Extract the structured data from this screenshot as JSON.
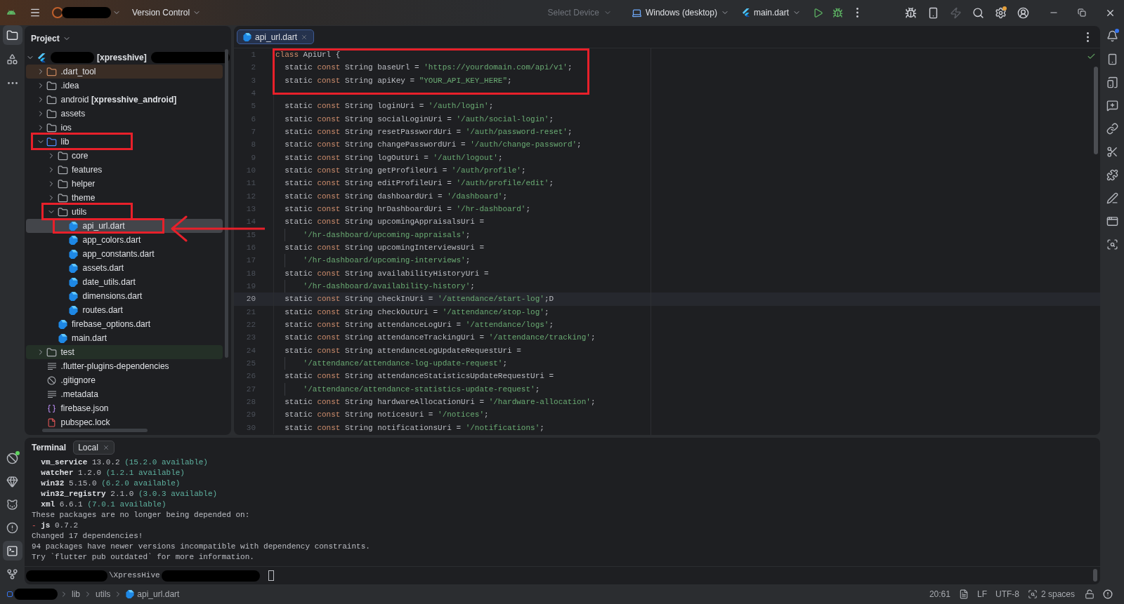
{
  "title_bar": {
    "vcs_menu": {
      "label": "Version Control"
    },
    "device_selector": {
      "label": "Select Device",
      "disabled": true
    },
    "target_selector": {
      "label": "Windows (desktop)"
    },
    "run_configuration": {
      "label": "main.dart"
    },
    "actions": [
      {
        "kind": "run",
        "disabled": false
      },
      {
        "kind": "debug",
        "disabled": false
      },
      {
        "kind": "more",
        "disabled": false
      }
    ],
    "tools": [
      {
        "kind": "attach-debugger",
        "disabled": false,
        "badge": false
      },
      {
        "kind": "device-mirroring",
        "disabled": false,
        "badge": false
      },
      {
        "kind": "hot-reload",
        "disabled": true,
        "badge": false
      },
      {
        "kind": "search",
        "disabled": false,
        "badge": false
      },
      {
        "kind": "settings",
        "disabled": false,
        "badge": true
      },
      {
        "kind": "account",
        "disabled": false,
        "badge": false
      }
    ]
  },
  "left_toolbar": {
    "top": [
      {
        "kind": "project",
        "selected": true
      },
      {
        "kind": "structure",
        "selected": false
      },
      {
        "kind": "more",
        "selected": false
      }
    ],
    "bottom": [
      {
        "kind": "inspector",
        "selected": false,
        "badge": true
      },
      {
        "kind": "gem",
        "selected": false,
        "badge": false
      },
      {
        "kind": "cat",
        "selected": false,
        "badge": false
      },
      {
        "kind": "problems",
        "selected": false,
        "badge": false
      },
      {
        "kind": "terminal",
        "selected": true,
        "badge": false
      },
      {
        "kind": "git",
        "selected": false,
        "badge": false
      }
    ]
  },
  "project_panel": {
    "title": "Project",
    "tree": [
      {
        "kind": "flutter-project",
        "label": "[xpresshive]",
        "expanded": true,
        "selected": false,
        "annotated": false,
        "arrow": false,
        "children": [
          {
            "kind": "excluded-folder",
            "label": ".dart_tool",
            "expanded": false,
            "selected": false,
            "annotated": false,
            "arrow": false
          },
          {
            "kind": "config-folder",
            "label": ".idea",
            "expanded": false,
            "selected": false,
            "annotated": false,
            "arrow": false
          },
          {
            "kind": "folder",
            "label": "android **[xpresshive_android]**",
            "expanded": false,
            "selected": false,
            "annotated": false,
            "arrow": false
          },
          {
            "kind": "folder",
            "label": "assets",
            "expanded": false,
            "selected": false,
            "annotated": false,
            "arrow": false
          },
          {
            "kind": "folder",
            "label": "ios",
            "expanded": false,
            "selected": false,
            "annotated": false,
            "arrow": false
          },
          {
            "kind": "source-folder",
            "label": "lib",
            "expanded": true,
            "selected": false,
            "annotated": true,
            "arrow": false,
            "children": [
              {
                "kind": "folder",
                "label": "core",
                "expanded": false,
                "selected": false,
                "annotated": false,
                "arrow": false
              },
              {
                "kind": "folder",
                "label": "features",
                "expanded": false,
                "selected": false,
                "annotated": false,
                "arrow": false
              },
              {
                "kind": "folder",
                "label": "helper",
                "expanded": false,
                "selected": false,
                "annotated": false,
                "arrow": false
              },
              {
                "kind": "folder",
                "label": "theme",
                "expanded": false,
                "selected": false,
                "annotated": false,
                "arrow": false
              },
              {
                "kind": "folder",
                "label": "utils",
                "expanded": true,
                "selected": false,
                "annotated": true,
                "arrow": false,
                "children": [
                  {
                    "kind": "dart-file",
                    "label": "api_url.dart",
                    "selected": true,
                    "annotated": true,
                    "arrow": true
                  },
                  {
                    "kind": "dart-file",
                    "label": "app_colors.dart",
                    "selected": false,
                    "annotated": false,
                    "arrow": false
                  },
                  {
                    "kind": "dart-file",
                    "label": "app_constants.dart",
                    "selected": false,
                    "annotated": false,
                    "arrow": false
                  },
                  {
                    "kind": "dart-file",
                    "label": "assets.dart",
                    "selected": false,
                    "annotated": false,
                    "arrow": false
                  },
                  {
                    "kind": "dart-file",
                    "label": "date_utils.dart",
                    "selected": false,
                    "annotated": false,
                    "arrow": false
                  },
                  {
                    "kind": "dart-file",
                    "label": "dimensions.dart",
                    "selected": false,
                    "annotated": false,
                    "arrow": false
                  },
                  {
                    "kind": "dart-file",
                    "label": "routes.dart",
                    "selected": false,
                    "annotated": false,
                    "arrow": false
                  }
                ]
              },
              {
                "kind": "dart-file",
                "label": "firebase_options.dart",
                "selected": false,
                "annotated": false,
                "arrow": false
              },
              {
                "kind": "dart-file",
                "label": "main.dart",
                "selected": false,
                "annotated": false,
                "arrow": false
              }
            ]
          },
          {
            "kind": "test-folder",
            "label": "test",
            "expanded": false,
            "selected": false,
            "annotated": false,
            "arrow": false
          },
          {
            "kind": "text-file",
            "label": ".flutter-plugins-dependencies",
            "selected": false,
            "annotated": false,
            "arrow": false
          },
          {
            "kind": "ignore-file",
            "label": ".gitignore",
            "selected": false,
            "annotated": false,
            "arrow": false
          },
          {
            "kind": "text-file",
            "label": ".metadata",
            "selected": false,
            "annotated": false,
            "arrow": false
          },
          {
            "kind": "json-file",
            "label": "firebase.json",
            "selected": false,
            "annotated": false,
            "arrow": false
          },
          {
            "kind": "lock-file",
            "label": "pubspec.lock",
            "selected": false,
            "annotated": false,
            "arrow": false
          }
        ]
      }
    ]
  },
  "editor": {
    "tabs": [
      {
        "label": "api_url.dart",
        "selected": true
      }
    ],
    "inspection_ok": true,
    "lines": [
      {
        "number": "1",
        "kind": "class",
        "current": false,
        "annotated": true,
        "segments": [
          {
            "kind": "keyword",
            "text": "class"
          },
          {
            "kind": "plain",
            "text": " ApiUrl {"
          }
        ]
      },
      {
        "number": "2",
        "kind": "member",
        "current": false,
        "annotated": true,
        "segments": [
          {
            "kind": "plain",
            "text": "static "
          },
          {
            "kind": "keyword",
            "text": "const"
          },
          {
            "kind": "plain",
            "text": " String baseUrl = "
          },
          {
            "kind": "string",
            "text": "'https://yourdomain.com/api/v1'"
          },
          {
            "kind": "plain",
            "text": ";"
          }
        ]
      },
      {
        "number": "3",
        "kind": "member",
        "current": false,
        "annotated": true,
        "segments": [
          {
            "kind": "plain",
            "text": "static "
          },
          {
            "kind": "keyword",
            "text": "const"
          },
          {
            "kind": "plain",
            "text": " String apiKey = "
          },
          {
            "kind": "string",
            "text": "\"YOUR_API_KEY_HERE\""
          },
          {
            "kind": "plain",
            "text": ";"
          }
        ]
      },
      {
        "number": "4",
        "kind": "blank",
        "current": false,
        "annotated": true
      },
      {
        "number": "5",
        "kind": "member",
        "current": false,
        "annotated": false,
        "segments": [
          {
            "kind": "plain",
            "text": "static "
          },
          {
            "kind": "keyword",
            "text": "const"
          },
          {
            "kind": "plain",
            "text": " String loginUri = "
          },
          {
            "kind": "string",
            "text": "'/auth/login'"
          },
          {
            "kind": "plain",
            "text": ";"
          }
        ]
      },
      {
        "number": "6",
        "kind": "member",
        "current": false,
        "annotated": false,
        "segments": [
          {
            "kind": "plain",
            "text": "static "
          },
          {
            "kind": "keyword",
            "text": "const"
          },
          {
            "kind": "plain",
            "text": " String socialLoginUri = "
          },
          {
            "kind": "string",
            "text": "'/auth/social-login'"
          },
          {
            "kind": "plain",
            "text": ";"
          }
        ]
      },
      {
        "number": "7",
        "kind": "member",
        "current": false,
        "annotated": false,
        "segments": [
          {
            "kind": "plain",
            "text": "static "
          },
          {
            "kind": "keyword",
            "text": "const"
          },
          {
            "kind": "plain",
            "text": " String resetPasswordUri = "
          },
          {
            "kind": "string",
            "text": "'/auth/password-reset'"
          },
          {
            "kind": "plain",
            "text": ";"
          }
        ]
      },
      {
        "number": "8",
        "kind": "member",
        "current": false,
        "annotated": false,
        "segments": [
          {
            "kind": "plain",
            "text": "static "
          },
          {
            "kind": "keyword",
            "text": "const"
          },
          {
            "kind": "plain",
            "text": " String changePasswordUri = "
          },
          {
            "kind": "string",
            "text": "'/auth/change-password'"
          },
          {
            "kind": "plain",
            "text": ";"
          }
        ]
      },
      {
        "number": "9",
        "kind": "member",
        "current": false,
        "annotated": false,
        "segments": [
          {
            "kind": "plain",
            "text": "static "
          },
          {
            "kind": "keyword",
            "text": "const"
          },
          {
            "kind": "plain",
            "text": " String logOutUri = "
          },
          {
            "kind": "string",
            "text": "'/auth/logout'"
          },
          {
            "kind": "plain",
            "text": ";"
          }
        ]
      },
      {
        "number": "10",
        "kind": "member",
        "current": false,
        "annotated": false,
        "segments": [
          {
            "kind": "plain",
            "text": "static "
          },
          {
            "kind": "keyword",
            "text": "const"
          },
          {
            "kind": "plain",
            "text": " String getProfileUri = "
          },
          {
            "kind": "string",
            "text": "'/auth/profile'"
          },
          {
            "kind": "plain",
            "text": ";"
          }
        ]
      },
      {
        "number": "11",
        "kind": "member",
        "current": false,
        "annotated": false,
        "segments": [
          {
            "kind": "plain",
            "text": "static "
          },
          {
            "kind": "keyword",
            "text": "const"
          },
          {
            "kind": "plain",
            "text": " String editProfileUri = "
          },
          {
            "kind": "string",
            "text": "'/auth/profile/edit'"
          },
          {
            "kind": "plain",
            "text": ";"
          }
        ]
      },
      {
        "number": "12",
        "kind": "member",
        "current": false,
        "annotated": false,
        "segments": [
          {
            "kind": "plain",
            "text": "static "
          },
          {
            "kind": "keyword",
            "text": "const"
          },
          {
            "kind": "plain",
            "text": " String dashboardUri = "
          },
          {
            "kind": "string",
            "text": "'/dashboard'"
          },
          {
            "kind": "plain",
            "text": ";"
          }
        ]
      },
      {
        "number": "13",
        "kind": "member",
        "current": false,
        "annotated": false,
        "segments": [
          {
            "kind": "plain",
            "text": "static "
          },
          {
            "kind": "keyword",
            "text": "const"
          },
          {
            "kind": "plain",
            "text": " String hrDashboardUri = "
          },
          {
            "kind": "string",
            "text": "'/hr-dashboard'"
          },
          {
            "kind": "plain",
            "text": ";"
          }
        ]
      },
      {
        "number": "14",
        "kind": "member",
        "current": false,
        "annotated": false,
        "segments": [
          {
            "kind": "plain",
            "text": "static "
          },
          {
            "kind": "keyword",
            "text": "const"
          },
          {
            "kind": "plain",
            "text": " String upcomingAppraisalsUri ="
          }
        ]
      },
      {
        "number": "15",
        "kind": "continuation",
        "current": false,
        "annotated": false,
        "segments": [
          {
            "kind": "string",
            "text": "'/hr-dashboard/upcoming-appraisals'"
          },
          {
            "kind": "plain",
            "text": ";"
          }
        ]
      },
      {
        "number": "16",
        "kind": "member",
        "current": false,
        "annotated": false,
        "segments": [
          {
            "kind": "plain",
            "text": "static "
          },
          {
            "kind": "keyword",
            "text": "const"
          },
          {
            "kind": "plain",
            "text": " String upcomingInterviewsUri ="
          }
        ]
      },
      {
        "number": "17",
        "kind": "continuation",
        "current": false,
        "annotated": false,
        "segments": [
          {
            "kind": "string",
            "text": "'/hr-dashboard/upcoming-interviews'"
          },
          {
            "kind": "plain",
            "text": ";"
          }
        ]
      },
      {
        "number": "18",
        "kind": "member",
        "current": false,
        "annotated": false,
        "segments": [
          {
            "kind": "plain",
            "text": "static "
          },
          {
            "kind": "keyword",
            "text": "const"
          },
          {
            "kind": "plain",
            "text": " String availabilityHistoryUri ="
          }
        ]
      },
      {
        "number": "19",
        "kind": "continuation",
        "current": false,
        "annotated": false,
        "segments": [
          {
            "kind": "string",
            "text": "'/hr-dashboard/availability-history'"
          },
          {
            "kind": "plain",
            "text": ";"
          }
        ]
      },
      {
        "number": "20",
        "kind": "member",
        "current": true,
        "annotated": false,
        "segments": [
          {
            "kind": "plain",
            "text": "static "
          },
          {
            "kind": "keyword",
            "text": "const"
          },
          {
            "kind": "plain",
            "text": " String checkInUri = "
          },
          {
            "kind": "string",
            "text": "'/attendance/start-log'"
          },
          {
            "kind": "plain",
            "text": ";D"
          }
        ]
      },
      {
        "number": "21",
        "kind": "member",
        "current": false,
        "annotated": false,
        "segments": [
          {
            "kind": "plain",
            "text": "static "
          },
          {
            "kind": "keyword",
            "text": "const"
          },
          {
            "kind": "plain",
            "text": " String checkOutUri = "
          },
          {
            "kind": "string",
            "text": "'/attendance/stop-log'"
          },
          {
            "kind": "plain",
            "text": ";"
          }
        ]
      },
      {
        "number": "22",
        "kind": "member",
        "current": false,
        "annotated": false,
        "segments": [
          {
            "kind": "plain",
            "text": "static "
          },
          {
            "kind": "keyword",
            "text": "const"
          },
          {
            "kind": "plain",
            "text": " String attendanceLogUri = "
          },
          {
            "kind": "string",
            "text": "'/attendance/logs'"
          },
          {
            "kind": "plain",
            "text": ";"
          }
        ]
      },
      {
        "number": "23",
        "kind": "member",
        "current": false,
        "annotated": false,
        "segments": [
          {
            "kind": "plain",
            "text": "static "
          },
          {
            "kind": "keyword",
            "text": "const"
          },
          {
            "kind": "plain",
            "text": " String attendanceTrackingUri = "
          },
          {
            "kind": "string",
            "text": "'/attendance/tracking'"
          },
          {
            "kind": "plain",
            "text": ";"
          }
        ]
      },
      {
        "number": "24",
        "kind": "member",
        "current": false,
        "annotated": false,
        "segments": [
          {
            "kind": "plain",
            "text": "static "
          },
          {
            "kind": "keyword",
            "text": "const"
          },
          {
            "kind": "plain",
            "text": " String attendanceLogUpdateRequestUri ="
          }
        ]
      },
      {
        "number": "25",
        "kind": "continuation",
        "current": false,
        "annotated": false,
        "segments": [
          {
            "kind": "string",
            "text": "'/attendance/attendance-log-update-request'"
          },
          {
            "kind": "plain",
            "text": ";"
          }
        ]
      },
      {
        "number": "26",
        "kind": "member",
        "current": false,
        "annotated": false,
        "segments": [
          {
            "kind": "plain",
            "text": "static "
          },
          {
            "kind": "keyword",
            "text": "const"
          },
          {
            "kind": "plain",
            "text": " String attendanceStatisticsUpdateRequestUri ="
          }
        ]
      },
      {
        "number": "27",
        "kind": "continuation",
        "current": false,
        "annotated": false,
        "segments": [
          {
            "kind": "string",
            "text": "'/attendance/attendance-statistics-update-request'"
          },
          {
            "kind": "plain",
            "text": ";"
          }
        ]
      },
      {
        "number": "28",
        "kind": "member",
        "current": false,
        "annotated": false,
        "segments": [
          {
            "kind": "plain",
            "text": "static "
          },
          {
            "kind": "keyword",
            "text": "const"
          },
          {
            "kind": "plain",
            "text": " String hardwareAllocationUri = "
          },
          {
            "kind": "string",
            "text": "'/hardware-allocation'"
          },
          {
            "kind": "plain",
            "text": ";"
          }
        ]
      },
      {
        "number": "29",
        "kind": "member",
        "current": false,
        "annotated": false,
        "segments": [
          {
            "kind": "plain",
            "text": "static "
          },
          {
            "kind": "keyword",
            "text": "const"
          },
          {
            "kind": "plain",
            "text": " String noticesUri = "
          },
          {
            "kind": "string",
            "text": "'/notices'"
          },
          {
            "kind": "plain",
            "text": ";"
          }
        ]
      },
      {
        "number": "30",
        "kind": "member",
        "current": false,
        "annotated": false,
        "segments": [
          {
            "kind": "plain",
            "text": "static "
          },
          {
            "kind": "keyword",
            "text": "const"
          },
          {
            "kind": "plain",
            "text": " String notificationsUri = "
          },
          {
            "kind": "string",
            "text": "'/notifications'"
          },
          {
            "kind": "plain",
            "text": ";"
          }
        ]
      }
    ]
  },
  "right_toolbar": {
    "items": [
      {
        "kind": "notifications",
        "badge": true
      },
      {
        "kind": "device-manager",
        "badge": false
      },
      {
        "kind": "running-devices",
        "badge": false
      },
      {
        "kind": "chat",
        "badge": false
      },
      {
        "kind": "link",
        "badge": false
      },
      {
        "kind": "scissors",
        "badge": false
      },
      {
        "kind": "puzzle",
        "badge": false
      },
      {
        "kind": "pen",
        "badge": false
      },
      {
        "kind": "preview",
        "badge": false
      },
      {
        "kind": "inspect",
        "badge": false
      }
    ]
  },
  "terminal": {
    "title": "Terminal",
    "tabs": [
      {
        "label": "Local",
        "selected": true
      }
    ],
    "output": [
      {
        "kind": "package",
        "segments": [
          {
            "kind": "bold",
            "text": "vm_service"
          },
          {
            "kind": "plain",
            "text": " 13.0.2 "
          },
          {
            "kind": "available",
            "text": "(15.2.0 available)"
          }
        ]
      },
      {
        "kind": "package",
        "segments": [
          {
            "kind": "bold",
            "text": "watcher"
          },
          {
            "kind": "plain",
            "text": " 1.2.0 "
          },
          {
            "kind": "available",
            "text": "(1.2.1 available)"
          }
        ]
      },
      {
        "kind": "package",
        "segments": [
          {
            "kind": "bold",
            "text": "win32"
          },
          {
            "kind": "plain",
            "text": " 5.15.0 "
          },
          {
            "kind": "available",
            "text": "(6.2.0 available)"
          }
        ]
      },
      {
        "kind": "package",
        "segments": [
          {
            "kind": "bold",
            "text": "win32_registry"
          },
          {
            "kind": "plain",
            "text": " 2.1.0 "
          },
          {
            "kind": "available",
            "text": "(3.0.3 available)"
          }
        ]
      },
      {
        "kind": "package",
        "segments": [
          {
            "kind": "bold",
            "text": "xml"
          },
          {
            "kind": "plain",
            "text": " 6.6.1 "
          },
          {
            "kind": "available",
            "text": "(7.0.1 available)"
          }
        ]
      },
      {
        "kind": "message",
        "segments": [
          {
            "kind": "plain",
            "text": "These packages are no longer being depended on:"
          }
        ]
      },
      {
        "kind": "message",
        "segments": [
          {
            "kind": "removed",
            "text": "-"
          },
          {
            "kind": "bold",
            "text": " js"
          },
          {
            "kind": "plain",
            "text": " 0.7.2"
          }
        ]
      },
      {
        "kind": "message",
        "segments": [
          {
            "kind": "plain",
            "text": "Changed 17 dependencies!"
          }
        ]
      },
      {
        "kind": "message",
        "segments": [
          {
            "kind": "plain",
            "text": "94 packages have newer versions incompatible with dependency constraints."
          }
        ]
      },
      {
        "kind": "message",
        "segments": [
          {
            "kind": "plain",
            "text": "Try `flutter pub outdated` for more information."
          }
        ]
      }
    ],
    "prompt": "\\XpressHive"
  },
  "status_bar": {
    "breadcrumbs": [
      {
        "kind": "folder",
        "label": "lib"
      },
      {
        "kind": "folder",
        "label": "utils"
      },
      {
        "kind": "dart-file",
        "label": "api_url.dart"
      }
    ],
    "caret_position": "20:61",
    "line_separator": "LF",
    "encoding": "UTF-8",
    "indent": "2 spaces"
  }
}
